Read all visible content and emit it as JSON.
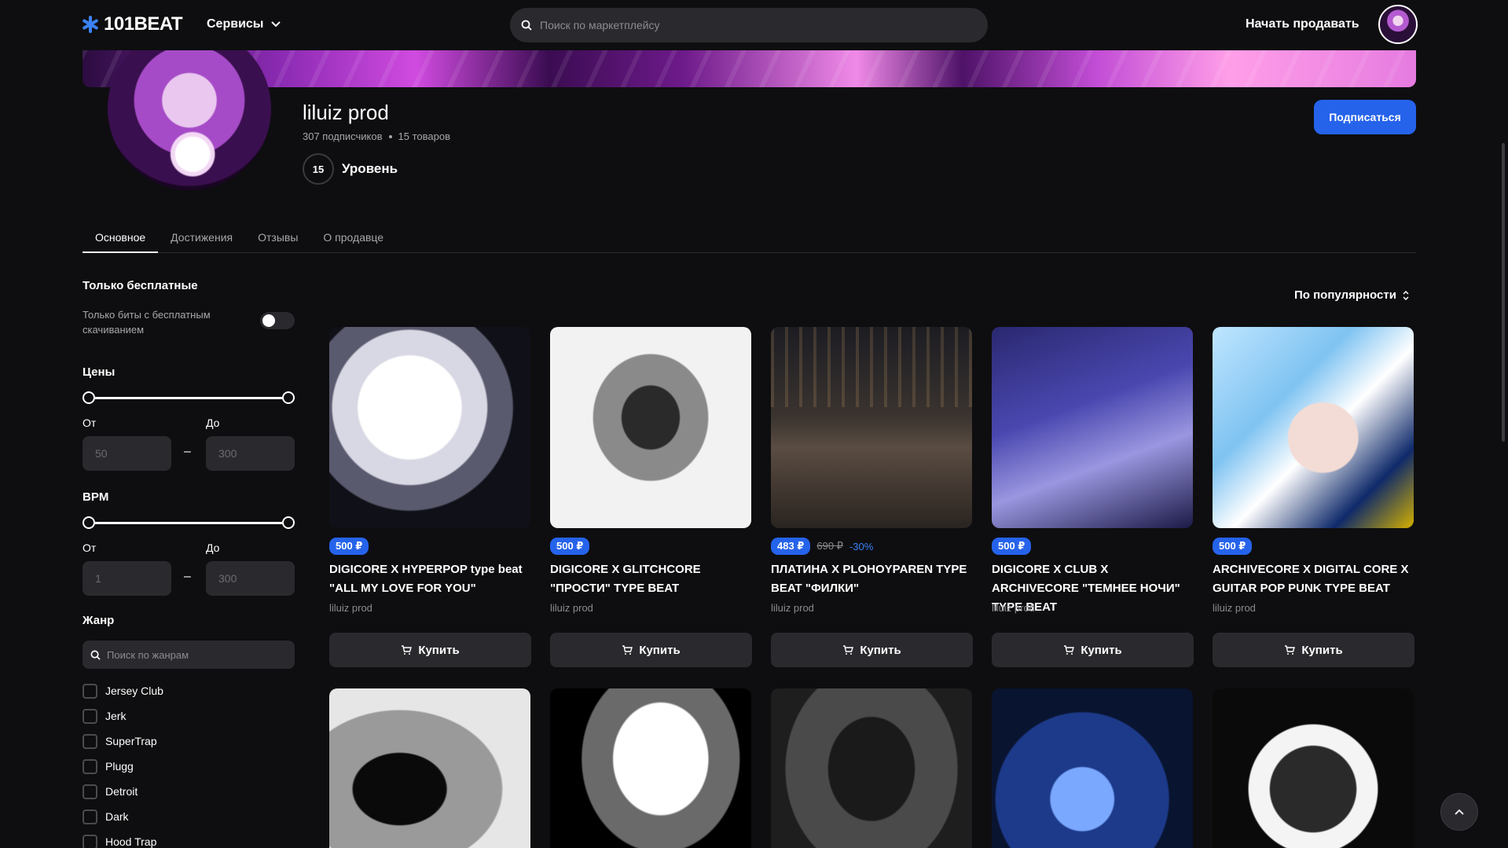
{
  "header": {
    "logo_text": "101BEAT",
    "services_label": "Сервисы",
    "search_placeholder": "Поиск по маркетплейсу",
    "sell_label": "Начать продавать"
  },
  "profile": {
    "name": "liluiz prod",
    "subscribers": "307 подписчиков",
    "products": "15 товаров",
    "level_number": "15",
    "level_label": "Уровень",
    "subscribe_label": "Подписаться"
  },
  "tabs": [
    {
      "label": "Основное",
      "active": true
    },
    {
      "label": "Достижения",
      "active": false
    },
    {
      "label": "Отзывы",
      "active": false
    },
    {
      "label": "О продавце",
      "active": false
    }
  ],
  "filters": {
    "free_title": "Только бесплатные",
    "free_desc": "Только биты с бесплатным скачиванием",
    "price_title": "Цены",
    "price_from_label": "От",
    "price_to_label": "До",
    "price_from_placeholder": "50",
    "price_to_placeholder": "300",
    "bpm_title": "BPM",
    "bpm_from_label": "От",
    "bpm_to_label": "До",
    "bpm_from_placeholder": "1",
    "bpm_to_placeholder": "300",
    "dash": "–",
    "genre_title": "Жанр",
    "genre_search_placeholder": "Поиск по жанрам",
    "genres": [
      "Jersey Club",
      "Jerk",
      "SuperTrap",
      "Plugg",
      "Detroit",
      "Dark",
      "Hood Trap"
    ]
  },
  "sort": {
    "label": "По популярности"
  },
  "products": [
    {
      "price": "500 ₽",
      "old_price": "",
      "discount": "",
      "title": "DIGICORE X HYPERPOP type beat \"ALL MY LOVE FOR YOU\"",
      "author": "liluiz prod",
      "buy_label": "Купить"
    },
    {
      "price": "500 ₽",
      "old_price": "",
      "discount": "",
      "title": "DIGICORE X GLITCHCORE \"ПРОСТИ\" TYPE BEAT",
      "author": "liluiz prod",
      "buy_label": "Купить"
    },
    {
      "price": "483 ₽",
      "old_price": "690 ₽",
      "discount": "-30%",
      "title": "ПЛАТИНА X PLOHOYPAREN TYPE BEAT \"ФИЛКИ\"",
      "author": "liluiz prod",
      "buy_label": "Купить"
    },
    {
      "price": "500 ₽",
      "old_price": "",
      "discount": "",
      "title": "DIGICORE X CLUB X ARCHIVECORE \"ТЕМНЕЕ НОЧИ\" TYPE BEAT",
      "author": "liluiz prod",
      "buy_label": "Купить"
    },
    {
      "price": "500 ₽",
      "old_price": "",
      "discount": "",
      "title": "ARCHIVECORE X DIGITAL CORE X GUITAR POP PUNK TYPE BEAT",
      "author": "liluiz prod",
      "buy_label": "Купить"
    }
  ],
  "colors": {
    "accent": "#2563eb",
    "background": "#0e0e10",
    "surface": "#2a2a2e"
  }
}
